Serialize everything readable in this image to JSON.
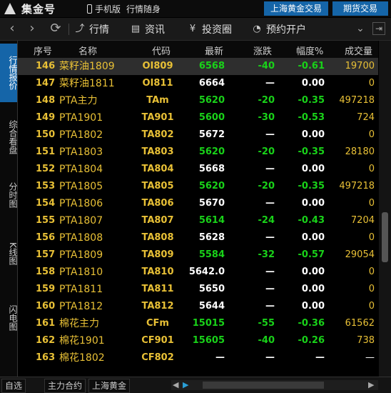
{
  "titlebar": {
    "logo_text": "集金号",
    "mobile_label": "手机版",
    "mobile_sub": "行情随身",
    "tabs": [
      "上海黄金交易",
      "期货交易"
    ]
  },
  "toolbar": {
    "back_icon": "chevron-left-icon",
    "forward_icon": "chevron-right-icon",
    "refresh_icon": "refresh-icon",
    "items": [
      "行情",
      "资讯",
      "投资圈",
      "预约开户"
    ]
  },
  "left_tabs": [
    "行情报价",
    "综合看盘",
    "分时图",
    "K线图",
    "闪电图"
  ],
  "table": {
    "headers": [
      "序号",
      "名称",
      "代码",
      "最新",
      "涨跌",
      "幅度%",
      "成交量"
    ],
    "rows": [
      {
        "idx": "146",
        "name": "菜籽油1809",
        "code": "OI809",
        "last": "6568",
        "chg": "-40",
        "pct": "-0.61",
        "vol": "19700",
        "dir": "down"
      },
      {
        "idx": "147",
        "name": "菜籽油1811",
        "code": "OI811",
        "last": "6664",
        "chg": "—",
        "pct": "0.00",
        "vol": "0",
        "dir": "flat"
      },
      {
        "idx": "148",
        "name": "PTA主力",
        "code": "TAm",
        "last": "5620",
        "chg": "-20",
        "pct": "-0.35",
        "vol": "497218",
        "dir": "down"
      },
      {
        "idx": "149",
        "name": "PTA1901",
        "code": "TA901",
        "last": "5600",
        "chg": "-30",
        "pct": "-0.53",
        "vol": "724",
        "dir": "down"
      },
      {
        "idx": "150",
        "name": "PTA1802",
        "code": "TA802",
        "last": "5672",
        "chg": "—",
        "pct": "0.00",
        "vol": "0",
        "dir": "flat"
      },
      {
        "idx": "151",
        "name": "PTA1803",
        "code": "TA803",
        "last": "5620",
        "chg": "-20",
        "pct": "-0.35",
        "vol": "28180",
        "dir": "down"
      },
      {
        "idx": "152",
        "name": "PTA1804",
        "code": "TA804",
        "last": "5668",
        "chg": "—",
        "pct": "0.00",
        "vol": "0",
        "dir": "flat"
      },
      {
        "idx": "153",
        "name": "PTA1805",
        "code": "TA805",
        "last": "5620",
        "chg": "-20",
        "pct": "-0.35",
        "vol": "497218",
        "dir": "down"
      },
      {
        "idx": "154",
        "name": "PTA1806",
        "code": "TA806",
        "last": "5670",
        "chg": "—",
        "pct": "0.00",
        "vol": "0",
        "dir": "flat"
      },
      {
        "idx": "155",
        "name": "PTA1807",
        "code": "TA807",
        "last": "5614",
        "chg": "-24",
        "pct": "-0.43",
        "vol": "7204",
        "dir": "down"
      },
      {
        "idx": "156",
        "name": "PTA1808",
        "code": "TA808",
        "last": "5628",
        "chg": "—",
        "pct": "0.00",
        "vol": "0",
        "dir": "flat"
      },
      {
        "idx": "157",
        "name": "PTA1809",
        "code": "TA809",
        "last": "5584",
        "chg": "-32",
        "pct": "-0.57",
        "vol": "29054",
        "dir": "down"
      },
      {
        "idx": "158",
        "name": "PTA1810",
        "code": "TA810",
        "last": "5642.0",
        "chg": "—",
        "pct": "0.00",
        "vol": "0",
        "dir": "flat"
      },
      {
        "idx": "159",
        "name": "PTA1811",
        "code": "TA811",
        "last": "5650",
        "chg": "—",
        "pct": "0.00",
        "vol": "0",
        "dir": "flat"
      },
      {
        "idx": "160",
        "name": "PTA1812",
        "code": "TA812",
        "last": "5644",
        "chg": "—",
        "pct": "0.00",
        "vol": "0",
        "dir": "flat"
      },
      {
        "idx": "161",
        "name": "棉花主力",
        "code": "CFm",
        "last": "15015",
        "chg": "-55",
        "pct": "-0.36",
        "vol": "61562",
        "dir": "down"
      },
      {
        "idx": "162",
        "name": "棉花1901",
        "code": "CF901",
        "last": "15605",
        "chg": "-40",
        "pct": "-0.26",
        "vol": "738",
        "dir": "down"
      },
      {
        "idx": "163",
        "name": "棉花1802",
        "code": "CF802",
        "last": "—",
        "chg": "—",
        "pct": "—",
        "vol": "—",
        "dir": "none"
      }
    ],
    "selected_index": 0
  },
  "bottom": {
    "tabs": [
      "自选",
      "主力合约",
      "上海黄金"
    ]
  },
  "colors": {
    "down": "#19d219",
    "flat": "#ffffff",
    "yellow": "#e8c036",
    "active_blue": "#1565a8"
  }
}
